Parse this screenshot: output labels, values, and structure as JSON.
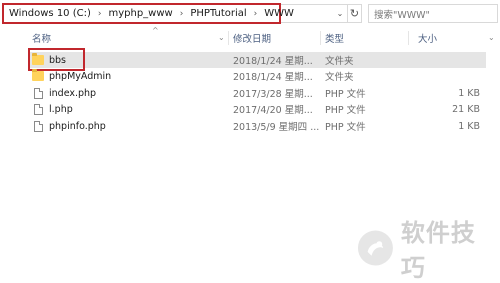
{
  "address": {
    "crumbs": [
      "Windows 10 (C:)",
      "myphp_www",
      "PHPTutorial",
      "WWW"
    ]
  },
  "search": {
    "placeholder": "搜索\"WWW\""
  },
  "columns": {
    "name": "名称",
    "date": "修改日期",
    "type": "类型",
    "size": "大小"
  },
  "files": [
    {
      "name": "bbs",
      "date": "2018/1/24 星期...",
      "type": "文件夹",
      "size": "",
      "kind": "folder-icon"
    },
    {
      "name": "phpMyAdmin",
      "date": "2018/1/24 星期...",
      "type": "文件夹",
      "size": "",
      "kind": "folder-icon"
    },
    {
      "name": "index.php",
      "date": "2017/3/28 星期...",
      "type": "PHP 文件",
      "size": "1 KB",
      "kind": "file-icon"
    },
    {
      "name": "l.php",
      "date": "2017/4/20 星期...",
      "type": "PHP 文件",
      "size": "21 KB",
      "kind": "file-icon"
    },
    {
      "name": "phpinfo.php",
      "date": "2013/5/9 星期四 ...",
      "type": "PHP 文件",
      "size": "1 KB",
      "kind": "file-icon"
    }
  ],
  "watermark": {
    "text": "软件技巧"
  },
  "colors": {
    "highlight": "#c1272d",
    "header_text": "#4d6082",
    "selected_row": "#e5e5e5"
  }
}
